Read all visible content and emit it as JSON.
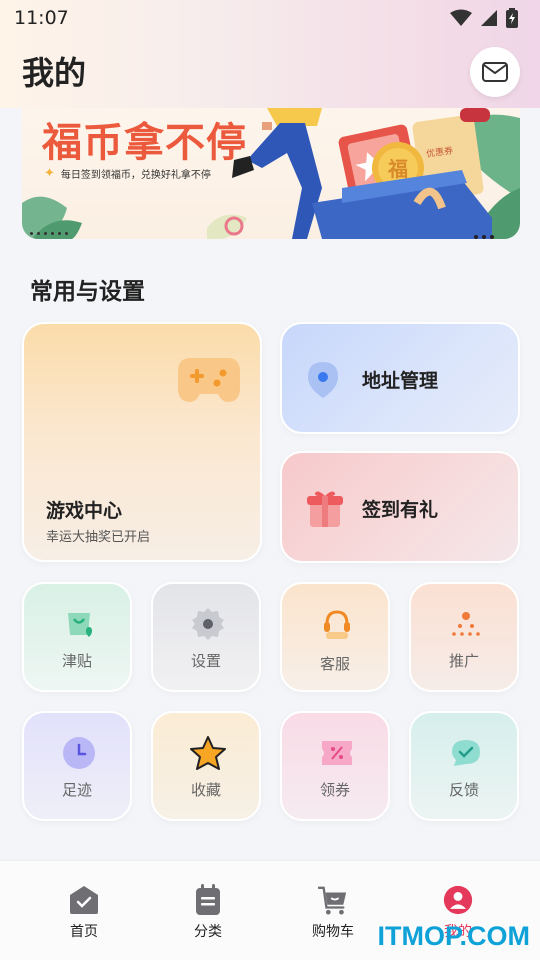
{
  "status": {
    "time": "11:07"
  },
  "header": {
    "title": "我的"
  },
  "icons": {
    "mail": "mail-icon",
    "game": "gamepad-icon",
    "address": "location-pin-icon",
    "gift": "gift-icon",
    "jintie": "shopping-bag-icon",
    "settings": "gear-icon",
    "service": "headset-icon",
    "promote": "share-network-icon",
    "footprint": "clock-icon",
    "collect": "star-icon",
    "coupon": "coupon-icon",
    "feedback": "chat-check-icon"
  },
  "banner": {
    "title": "福币拿不停",
    "subtitle": "每日签到领福币，兑换好礼拿不停",
    "coin_text": "福",
    "ticket_text": "优惠券"
  },
  "section": {
    "title": "常用与设置"
  },
  "cards": {
    "game": {
      "title": "游戏中心",
      "subtitle": "幸运大抽奖已开启"
    },
    "address": {
      "label": "地址管理"
    },
    "gift": {
      "label": "签到有礼"
    }
  },
  "grid": {
    "jintie": "津贴",
    "settings": "设置",
    "service": "客服",
    "promote": "推广",
    "footprint": "足迹",
    "collect": "收藏",
    "coupon": "领券",
    "feedback": "反馈"
  },
  "nav": {
    "home": "首页",
    "category": "分类",
    "cart": "购物车",
    "mine": "我的"
  },
  "colors": {
    "accent": "#e4395b",
    "banner_title": "#ec5a3d"
  },
  "watermark": "ITMOP.COM"
}
